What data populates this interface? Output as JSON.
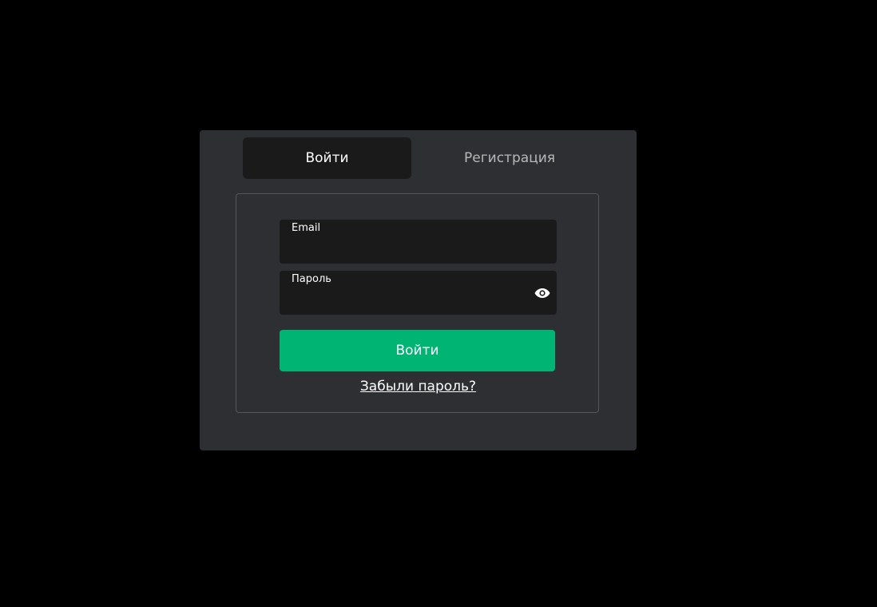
{
  "tabs": {
    "login_label": "Войти",
    "register_label": "Регистрация",
    "active": "login"
  },
  "form": {
    "email": {
      "label": "Email",
      "value": "",
      "placeholder": ""
    },
    "password": {
      "label": "Пароль",
      "value": "",
      "placeholder": ""
    },
    "submit_label": "Войти",
    "forgot_label": "Забыли пароль?"
  },
  "icons": {
    "password_toggle": "eye-icon"
  },
  "colors": {
    "background": "#000000",
    "modal": "#2e2f33",
    "field": "#1a1a1a",
    "accent": "#00b574",
    "inactive_tab_text": "#b8b8b8"
  }
}
